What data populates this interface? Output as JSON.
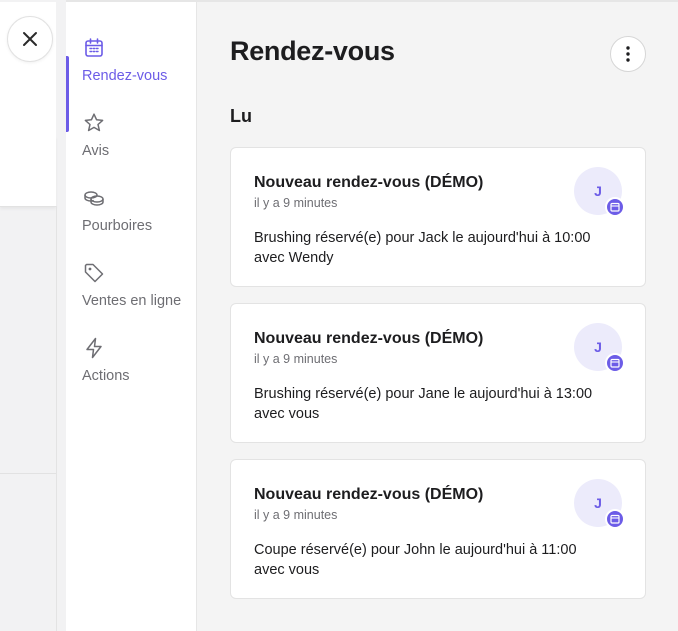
{
  "close_label": "Fermer",
  "sidebar": {
    "items": [
      {
        "label": "Rendez-vous",
        "icon": "calendar-icon",
        "active": true
      },
      {
        "label": "Avis",
        "icon": "star-icon",
        "active": false
      },
      {
        "label": "Pourboires",
        "icon": "coins-icon",
        "active": false
      },
      {
        "label": "Ventes en ligne",
        "icon": "tag-icon",
        "active": false
      },
      {
        "label": "Actions",
        "icon": "lightning-icon",
        "active": false
      }
    ]
  },
  "main": {
    "title": "Rendez-vous",
    "section": "Lu",
    "notifications": [
      {
        "title": "Nouveau rendez-vous (DÉMO)",
        "time": "il y a 9 minutes",
        "body": "Brushing réservé(e) pour Jack le aujourd'hui à 10:00 avec Wendy",
        "avatar": "J"
      },
      {
        "title": "Nouveau rendez-vous (DÉMO)",
        "time": "il y a 9 minutes",
        "body": "Brushing réservé(e) pour Jane le aujourd'hui à 13:00 avec vous",
        "avatar": "J"
      },
      {
        "title": "Nouveau rendez-vous (DÉMO)",
        "time": "il y a 9 minutes",
        "body": "Coupe réservé(e) pour John le aujourd'hui à 11:00 avec vous",
        "avatar": "J"
      }
    ]
  },
  "colors": {
    "accent": "#6c5ce7",
    "avatar_bg": "#ecebfb",
    "muted_text": "#6e6e73"
  }
}
